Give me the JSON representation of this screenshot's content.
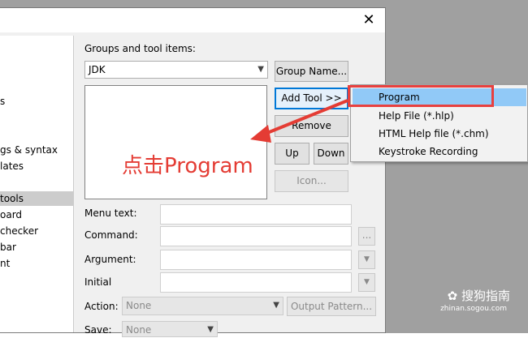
{
  "groups_label": "Groups and tool items:",
  "group_select": "JDK",
  "buttons": {
    "group_name": "Group Name...",
    "add_tool": "Add Tool >>",
    "remove": "Remove",
    "up": "Up",
    "down": "Down",
    "icon": "Icon...",
    "ellipsis": "...",
    "output_pattern": "Output Pattern..."
  },
  "left_items": [
    "s",
    "gs & syntax",
    "lates",
    "tools",
    "oard",
    "checker",
    "bar",
    "nt"
  ],
  "fields": {
    "menu_text": "Menu text:",
    "command": "Command:",
    "argument": "Argument:",
    "initial": "Initial",
    "action": "Action:",
    "action_value": "None",
    "save": "Save:",
    "save_value": "None"
  },
  "popup_menu": [
    "Program",
    "Help File (*.hlp)",
    "HTML Help file (*.chm)",
    "Keystroke Recording"
  ],
  "annotation": "点击Program",
  "watermark": {
    "brand": "搜狗指南",
    "url": "zhinan.sogou.com"
  }
}
